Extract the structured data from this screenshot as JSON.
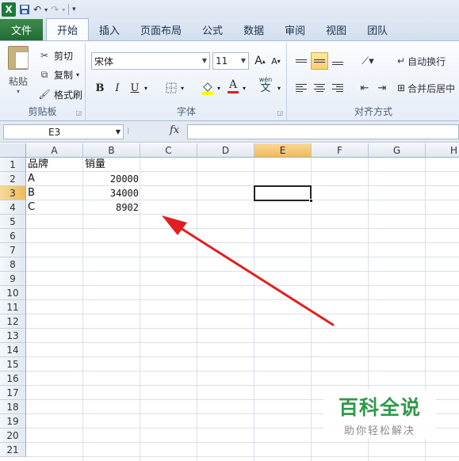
{
  "quick_access": {
    "logo": "X"
  },
  "tabs": [
    "文件",
    "开始",
    "插入",
    "页面布局",
    "公式",
    "数据",
    "审阅",
    "视图",
    "团队"
  ],
  "clipboard": {
    "paste": "粘贴",
    "cut": "剪切",
    "copy": "复制",
    "format_painter": "格式刷",
    "label": "剪贴板"
  },
  "font": {
    "name": "宋体",
    "size": "11",
    "bold": "B",
    "italic": "I",
    "underline": "U",
    "phonetic": "wén",
    "phonetic_char": "文",
    "label": "字体"
  },
  "alignment": {
    "wrap_text": "自动换行",
    "merge_center": "合并后居中",
    "label": "对齐方式"
  },
  "formula_bar": {
    "name_box": "E3",
    "fx": "fx",
    "value": ""
  },
  "sheet": {
    "columns": [
      "A",
      "B",
      "C",
      "D",
      "E",
      "F",
      "G",
      "H"
    ],
    "selected_column": "E",
    "rows": [
      "1",
      "2",
      "3",
      "4",
      "5",
      "6",
      "7",
      "8",
      "9",
      "10",
      "11",
      "12",
      "13",
      "14",
      "15",
      "16",
      "17",
      "18",
      "19",
      "20",
      "21"
    ],
    "selected_row": "3",
    "cells": {
      "A1": "品牌",
      "B1": "销量",
      "A2": "A",
      "B2": "20000",
      "A3": "B",
      "B3": "34000",
      "A4": "C",
      "B4": "8902"
    }
  },
  "watermark": {
    "title": "百科全说",
    "subtitle": "助你轻松解决"
  },
  "colors": {
    "excel_green": "#2f9a49",
    "arrow_red": "#e02020",
    "selection": "#f1b95a"
  }
}
